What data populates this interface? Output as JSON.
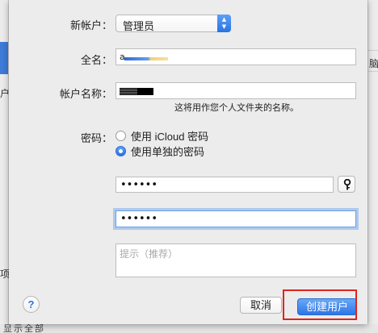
{
  "background": {
    "left_glyphs": [
      "户",
      "项"
    ],
    "right_glyphs": [
      "脑"
    ],
    "bottom_glyphs": "显示全部"
  },
  "form": {
    "new_account_label": "新帐户：",
    "account_type_value": "管理员",
    "full_name_label": "全名：",
    "full_name_value": "a",
    "account_name_label": "帐户名称：",
    "account_name_helper": "这将用作您个人文件夹的名称。",
    "password_label": "密码：",
    "radio_icloud_label": "使用 iCloud 密码",
    "radio_separate_label": "使用单独的密码",
    "selected_radio": "separate",
    "password_value": "••••••",
    "verify_value": "••••••",
    "hint_placeholder": "提示（推荐）"
  },
  "buttons": {
    "help_label": "?",
    "cancel_label": "取消",
    "create_label": "创建用户"
  },
  "colors": {
    "accent": "#2a72e5",
    "highlight": "#e0231e"
  },
  "icons": {
    "stepper": "up-down-chevrons",
    "key": "key-icon"
  }
}
